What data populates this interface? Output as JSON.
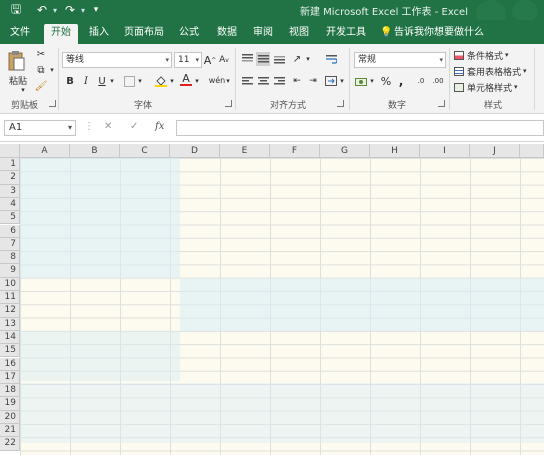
{
  "title": "新建 Microsoft Excel 工作表 - Excel",
  "quick_access": {
    "save": "🖫",
    "undo": "↶",
    "redo": "↷",
    "customize": "▾"
  },
  "tabs": [
    "文件",
    "开始",
    "插入",
    "页面布局",
    "公式",
    "数据",
    "审阅",
    "视图",
    "开发工具"
  ],
  "tell_me": "告诉我你想要做什么",
  "ribbon": {
    "clipboard": {
      "paste_label": "粘贴",
      "group_label": "剪贴板"
    },
    "font": {
      "name": "等线",
      "size": "11",
      "bold": "B",
      "italic": "I",
      "underline": "U",
      "grow": "A",
      "shrink": "A",
      "font_color": "A",
      "wen": "wén",
      "group_label": "字体"
    },
    "alignment": {
      "group_label": "对齐方式"
    },
    "number": {
      "format": "常规",
      "percent": "%",
      "comma": ",",
      "inc": ".0",
      "dec": ".00",
      "group_label": "数字"
    },
    "styles": {
      "conditional": "条件格式",
      "table": "套用表格格式",
      "cell": "单元格样式",
      "group_label": "样式"
    }
  },
  "formula_bar": {
    "name_box": "A1",
    "cancel": "✕",
    "enter": "✓",
    "fx": "fx"
  },
  "columns": [
    "A",
    "B",
    "C",
    "D",
    "E",
    "F",
    "G",
    "H",
    "I",
    "J"
  ],
  "rows": [
    "1",
    "2",
    "3",
    "4",
    "5",
    "6",
    "7",
    "8",
    "9",
    "10",
    "11",
    "12",
    "13",
    "14",
    "15",
    "16",
    "17",
    "18",
    "19",
    "20",
    "21",
    "22"
  ],
  "colors": {
    "accent": "#217346",
    "cell_cream": "#fdfbef",
    "cell_blue": "#e9f5fb"
  }
}
